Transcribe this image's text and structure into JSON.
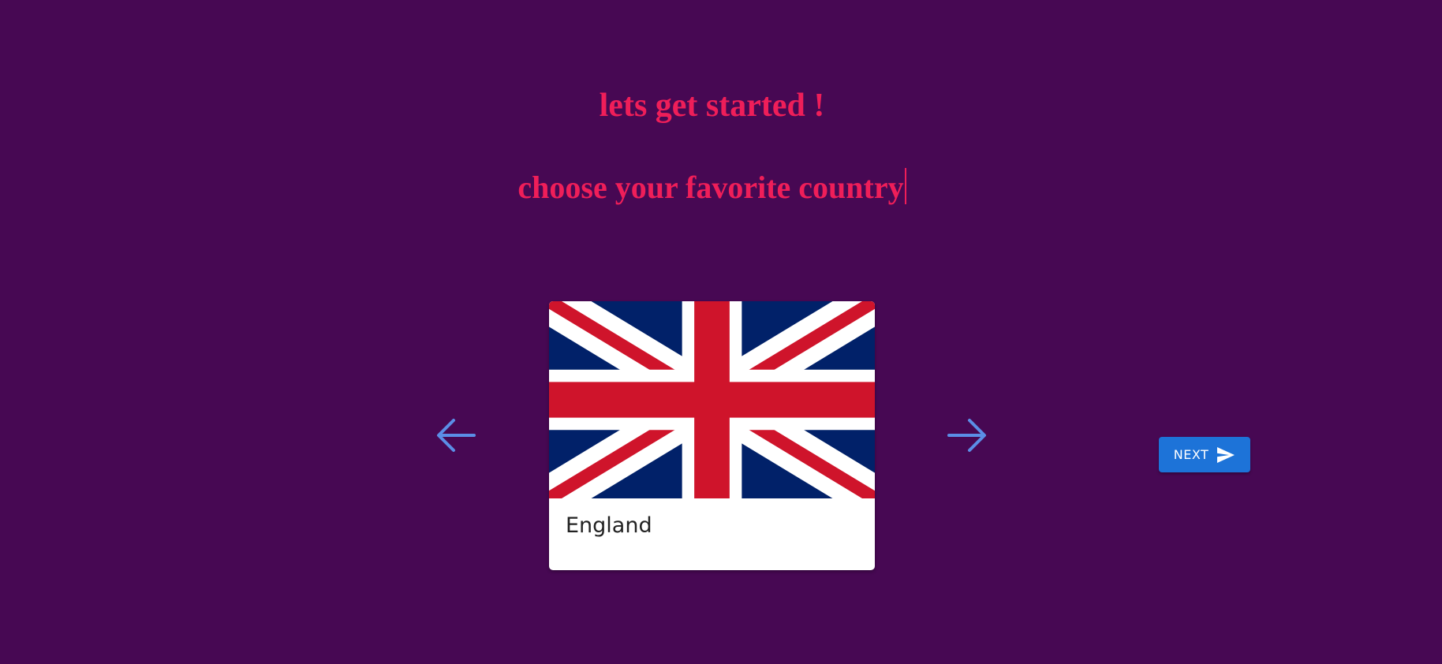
{
  "header": {
    "title": "lets get started !",
    "subtitle": "choose your favorite country"
  },
  "carousel": {
    "prev_icon": "arrow-left-icon",
    "next_icon": "arrow-right-icon",
    "selected": {
      "country": "England",
      "flag": "union-jack-flag"
    }
  },
  "actions": {
    "next_label": "NEXT",
    "next_icon": "send-icon"
  },
  "colors": {
    "background": "#470853",
    "heading": "#ef1e59",
    "arrow": "#5b8ee6",
    "button": "#1d73d8",
    "flag_blue": "#012169",
    "flag_red": "#cf142b"
  }
}
